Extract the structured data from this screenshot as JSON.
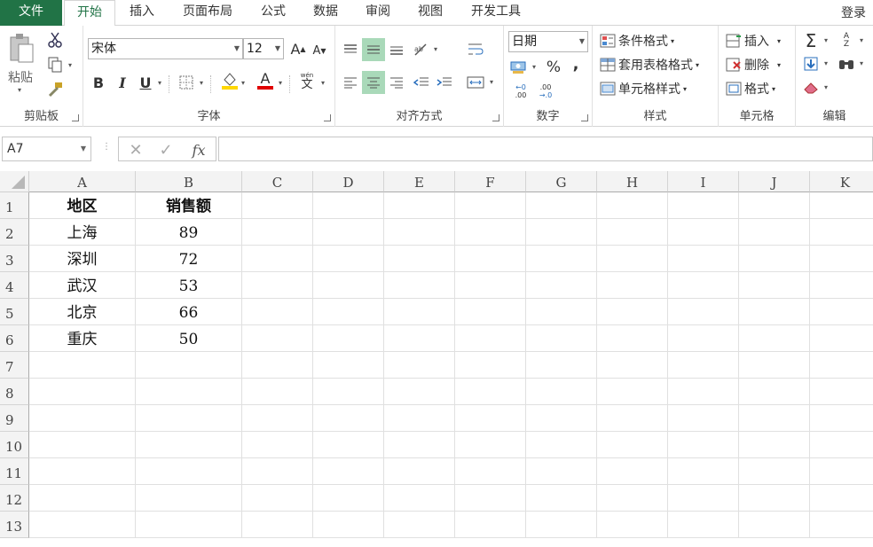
{
  "tabs": {
    "file": "文件",
    "home": "开始",
    "insert": "插入",
    "layout": "页面布局",
    "formula": "公式",
    "data": "数据",
    "review": "审阅",
    "view": "视图",
    "developer": "开发工具",
    "login": "登录"
  },
  "clipboard": {
    "paste": "粘贴",
    "label": "剪贴板"
  },
  "font": {
    "name": "宋体",
    "size": "12",
    "grow": "A",
    "shrink": "A",
    "bold": "B",
    "italic": "I",
    "underline": "U",
    "font_color_glyph": "A",
    "phonetic_glyph": "文",
    "phonetic_top": "wén",
    "label": "字体"
  },
  "alignment": {
    "label": "对齐方式"
  },
  "number": {
    "format": "日期",
    "percent": "%",
    "comma": ",",
    "inc_decimal": ".00",
    "dec_decimal": ".0",
    "label": "数字"
  },
  "styles": {
    "conditional": "条件格式",
    "table_format": "套用表格格式",
    "cell_styles": "单元格样式",
    "label": "样式"
  },
  "cells": {
    "insert": "插入",
    "delete": "删除",
    "format": "格式",
    "label": "单元格"
  },
  "editing": {
    "sum": "Σ",
    "sort": "Z",
    "label": "编辑"
  },
  "formula_bar": {
    "name_box": "A7",
    "fx": "fx",
    "value": ""
  },
  "colors": {
    "accent": "#217346",
    "selected": "#a9d9b9",
    "font_color": "#e00000",
    "highlight": "#ffd700"
  },
  "sheet": {
    "columns": [
      "A",
      "B",
      "C",
      "D",
      "E",
      "F",
      "G",
      "H",
      "I",
      "J",
      "K"
    ],
    "rows": [
      "1",
      "2",
      "3",
      "4",
      "5",
      "6",
      "7",
      "8",
      "9",
      "10",
      "11",
      "12",
      "13"
    ],
    "data": [
      [
        "地区",
        "销售额"
      ],
      [
        "上海",
        "89"
      ],
      [
        "深圳",
        "72"
      ],
      [
        "武汉",
        "53"
      ],
      [
        "北京",
        "66"
      ],
      [
        "重庆",
        "50"
      ]
    ]
  }
}
